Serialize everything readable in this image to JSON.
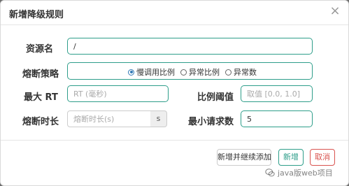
{
  "dialog": {
    "title": "新增降级规则",
    "close_icon": "close-icon"
  },
  "form": {
    "resource": {
      "label": "资源名",
      "value": "/"
    },
    "strategy": {
      "label": "熔断策略",
      "options": [
        "慢调用比例",
        "异常比例",
        "异常数"
      ],
      "selected": "慢调用比例"
    },
    "max_rt": {
      "label": "最大 RT",
      "placeholder": "RT (毫秒)"
    },
    "ratio_threshold": {
      "label": "比例阈值",
      "placeholder": "取值 [0.0, 1.0]"
    },
    "break_duration": {
      "label": "熔断时长",
      "placeholder": "熔断时长(s)",
      "unit": "s"
    },
    "min_requests": {
      "label": "最小请求数",
      "value": "5"
    }
  },
  "footer": {
    "save_continue_label": "新增并继续添加",
    "save_label": "新增",
    "cancel_label": "取消"
  },
  "watermark": {
    "text": "java版web项目",
    "icon": "wechat-icon"
  },
  "colors": {
    "accent": "#2e9e8a",
    "danger": "#d9534f",
    "radio": "#337ab7"
  }
}
